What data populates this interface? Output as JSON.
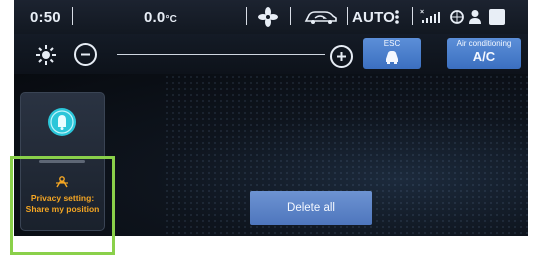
{
  "statusbar": {
    "time": "0:50",
    "temperature": "0.0",
    "temperature_unit": "°C",
    "auto_label": "AUTO",
    "signal_tag": "ooo00"
  },
  "controls": {
    "esc_label": "ESC",
    "ac_label": "Air conditioning",
    "ac_value": "A/C"
  },
  "notification": {
    "line1": "Privacy setting:",
    "line2": "Share my position"
  },
  "delete_all_label": "Delete all",
  "colors": {
    "accent_blue": "#4e76bd",
    "privacy_orange": "#f5a623",
    "highlight_green": "#8ad04a",
    "notification_icon": "#2bc6d9"
  }
}
